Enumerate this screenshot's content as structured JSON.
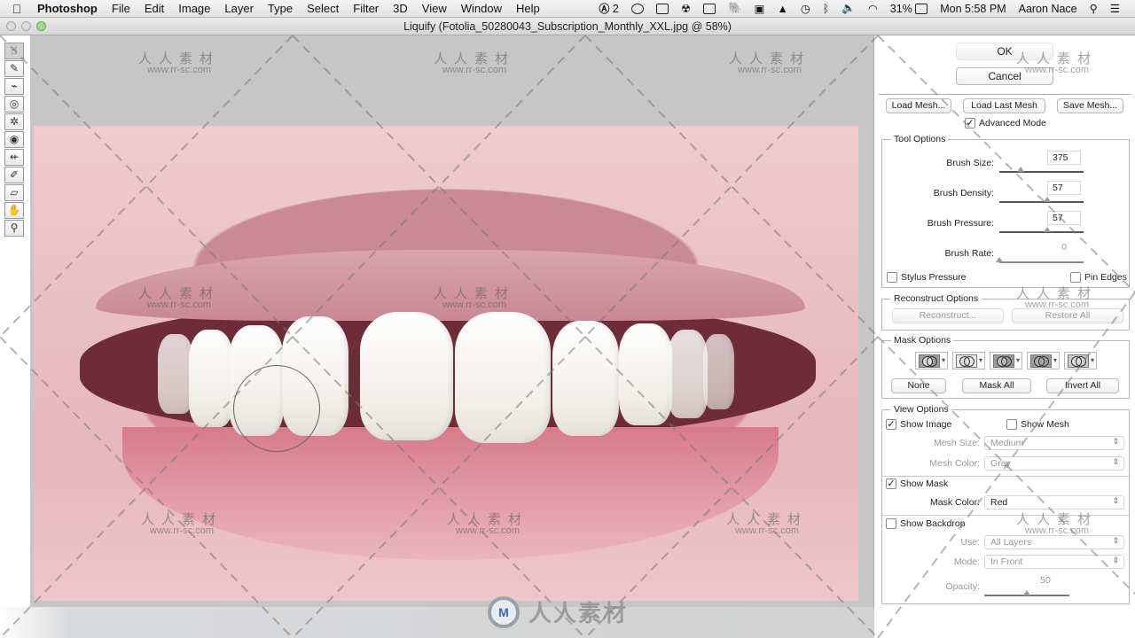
{
  "menubar": {
    "app": "Photoshop",
    "items": [
      "File",
      "Edit",
      "Image",
      "Layer",
      "Type",
      "Select",
      "Filter",
      "3D",
      "View",
      "Window",
      "Help"
    ],
    "status": {
      "adobe_badge": "2",
      "battery": "31%",
      "clock": "Mon 5:58 PM",
      "user": "Aaron Nace"
    }
  },
  "window": {
    "title": "Liquify (Fotolia_50280043_Subscription_Monthly_XXL.jpg @ 58%)"
  },
  "tools": [
    {
      "name": "forward-warp-tool",
      "glyph": "☝"
    },
    {
      "name": "reconstruct-tool",
      "glyph": "✎"
    },
    {
      "name": "smooth-tool",
      "glyph": "⌁"
    },
    {
      "name": "twirl-clockwise-tool",
      "glyph": "◎"
    },
    {
      "name": "pucker-tool",
      "glyph": "✲"
    },
    {
      "name": "bloat-tool",
      "glyph": "◉"
    },
    {
      "name": "push-left-tool",
      "glyph": "⇷"
    },
    {
      "name": "freeze-mask-tool",
      "glyph": "✐"
    },
    {
      "name": "thaw-mask-tool",
      "glyph": "▱"
    },
    {
      "name": "hand-tool",
      "glyph": "✋"
    },
    {
      "name": "zoom-tool",
      "glyph": "⚲"
    }
  ],
  "watermark": {
    "cn": "人人素材",
    "url": "www.rr-sc.com",
    "logo_text": "人人素材",
    "logo_mark": "M"
  },
  "panel": {
    "ok": "OK",
    "cancel": "Cancel",
    "load_mesh": "Load Mesh...",
    "load_last_mesh": "Load Last Mesh",
    "save_mesh": "Save Mesh...",
    "advanced_mode": {
      "label": "Advanced Mode",
      "checked": true
    },
    "tool_options": {
      "title": "Tool Options",
      "brush_size": {
        "label": "Brush Size:",
        "value": "375",
        "slider": 0.25
      },
      "brush_density": {
        "label": "Brush Density:",
        "value": "57",
        "slider": 0.57
      },
      "brush_pressure": {
        "label": "Brush Pressure:",
        "value": "57",
        "slider": 0.57
      },
      "brush_rate": {
        "label": "Brush Rate:",
        "value": "0",
        "slider": 0.0
      },
      "stylus_pressure": {
        "label": "Stylus Pressure",
        "checked": false
      },
      "pin_edges": {
        "label": "Pin Edges",
        "checked": false
      }
    },
    "reconstruct_options": {
      "title": "Reconstruct Options",
      "reconstruct": "Reconstruct...",
      "restore_all": "Restore All"
    },
    "mask_options": {
      "title": "Mask Options",
      "modes": [
        "replace-selection",
        "add-to-selection",
        "subtract-from-selection",
        "intersect-with-selection",
        "invert-selection"
      ],
      "none": "None",
      "mask_all": "Mask All",
      "invert_all": "Invert All"
    },
    "view_options": {
      "title": "View Options",
      "show_image": {
        "label": "Show Image",
        "checked": true
      },
      "show_mesh": {
        "label": "Show Mesh",
        "checked": false
      },
      "mesh_size": {
        "label": "Mesh Size:",
        "value": "Medium"
      },
      "mesh_color": {
        "label": "Mesh Color:",
        "value": "Gray"
      },
      "show_mask": {
        "label": "Show Mask",
        "checked": true
      },
      "mask_color": {
        "label": "Mask Color:",
        "value": "Red"
      },
      "show_backdrop": {
        "label": "Show Backdrop",
        "checked": false
      },
      "use": {
        "label": "Use:",
        "value": "All Layers"
      },
      "mode": {
        "label": "Mode:",
        "value": "In Front"
      },
      "opacity": {
        "label": "Opacity:",
        "value": "50",
        "slider": 0.5
      }
    }
  }
}
